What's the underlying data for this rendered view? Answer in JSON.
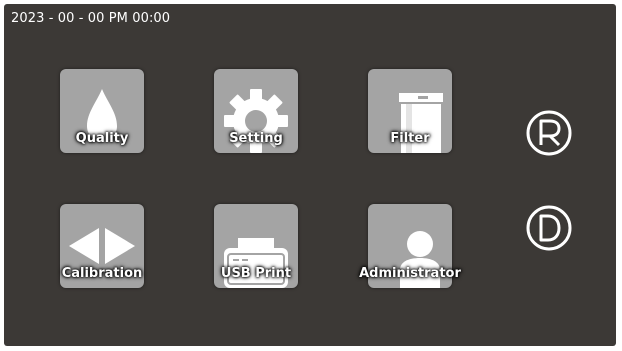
{
  "status_bar": {
    "datetime": "2023 - 00 - 00 PM 00:00"
  },
  "menu": {
    "tiles": [
      {
        "label": "Quality",
        "icon": "water-drop-icon"
      },
      {
        "label": "Setting",
        "icon": "gear-icon"
      },
      {
        "label": "Filter",
        "icon": "filter-cartridge-icon"
      },
      {
        "label": "Calibration",
        "icon": "calibration-arrows-icon"
      },
      {
        "label": "USB Print",
        "icon": "printer-icon"
      },
      {
        "label": "Administrator",
        "icon": "user-icon"
      }
    ]
  },
  "side_buttons": {
    "r_icon": "registered-r-icon",
    "d_icon": "circled-d-icon"
  },
  "colors": {
    "background": "#3c3936",
    "tile": "#a4a4a4",
    "icon": "#ffffff",
    "text": "#ffffff"
  }
}
